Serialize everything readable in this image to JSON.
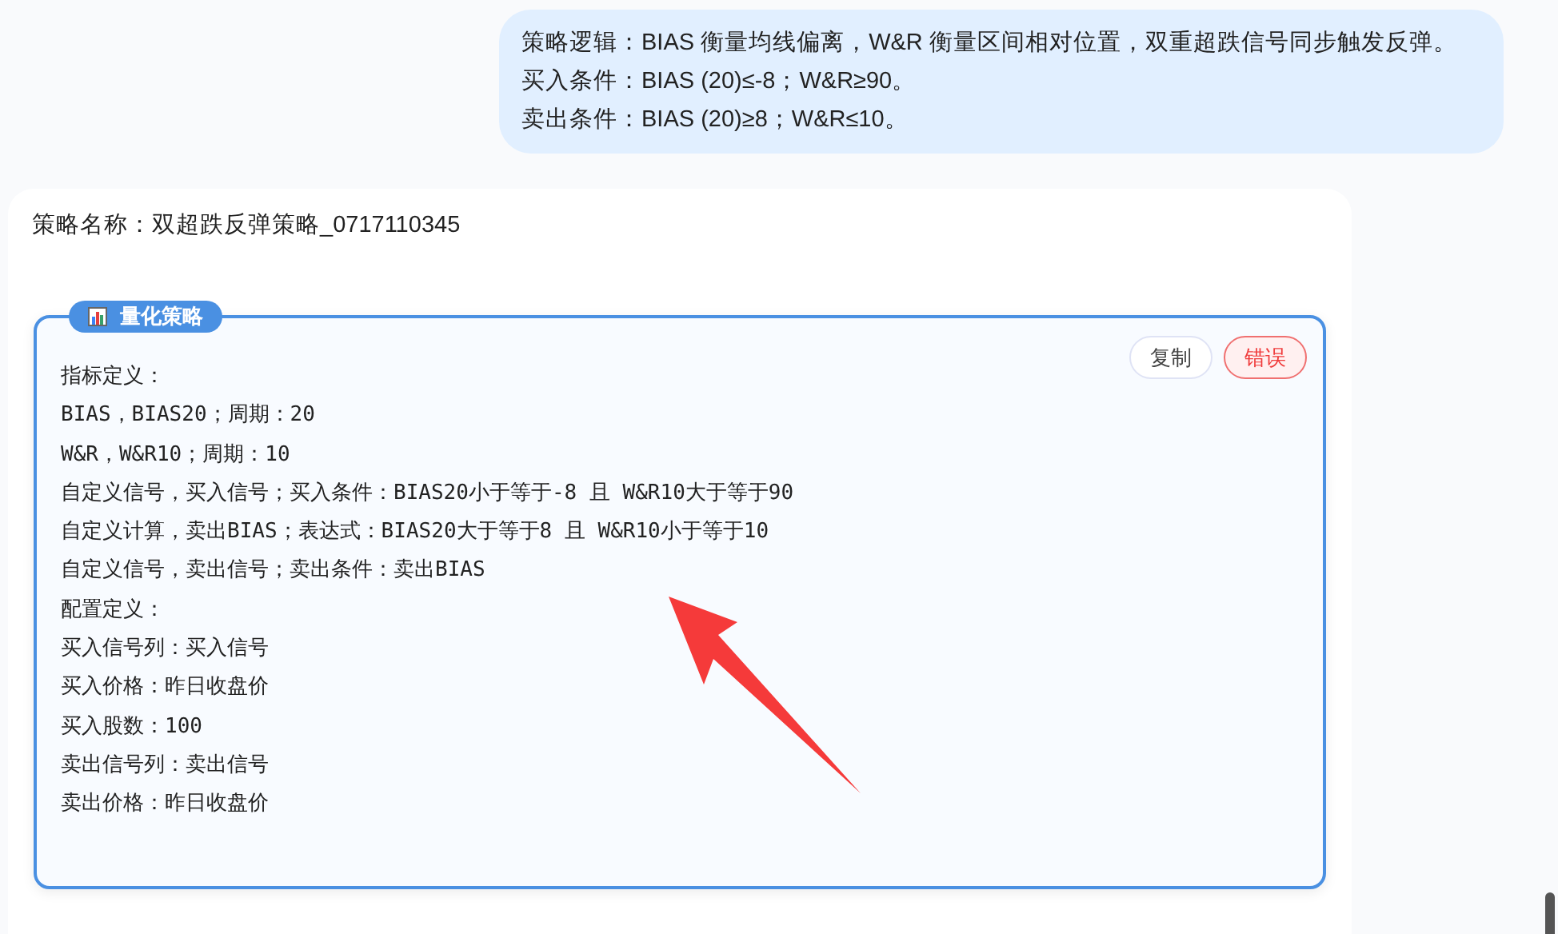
{
  "user_message": {
    "lines": [
      "策略逻辑：BIAS 衡量均线偏离，W&R 衡量区间相对位置，双重超跌信号同步触发反弹。",
      "买入条件：BIAS (20)≤-8；W&R≥90。",
      "卖出条件：BIAS (20)≥8；W&R≤10。"
    ]
  },
  "reply": {
    "strategy_name": "策略名称：双超跌反弹策略_0717110345",
    "panel": {
      "title": "量化策略",
      "actions": [
        {
          "label": "复制",
          "kind": "default"
        },
        {
          "label": "错误",
          "kind": "danger"
        }
      ],
      "lines": [
        "指标定义：",
        "BIAS，BIAS20；周期：20",
        "W&R，W&R10；周期：10",
        "自定义信号，买入信号；买入条件：BIAS20小于等于-8 且 W&R10大于等于90",
        "自定义计算，卖出BIAS；表达式：BIAS20大于等于8 且 W&R10小于等于10",
        "自定义信号，卖出信号；卖出条件：卖出BIAS",
        "配置定义：",
        "买入信号列：买入信号",
        "买入价格：昨日收盘价",
        "买入股数：100",
        "卖出信号列：卖出信号",
        "卖出价格：昨日收盘价"
      ]
    }
  }
}
